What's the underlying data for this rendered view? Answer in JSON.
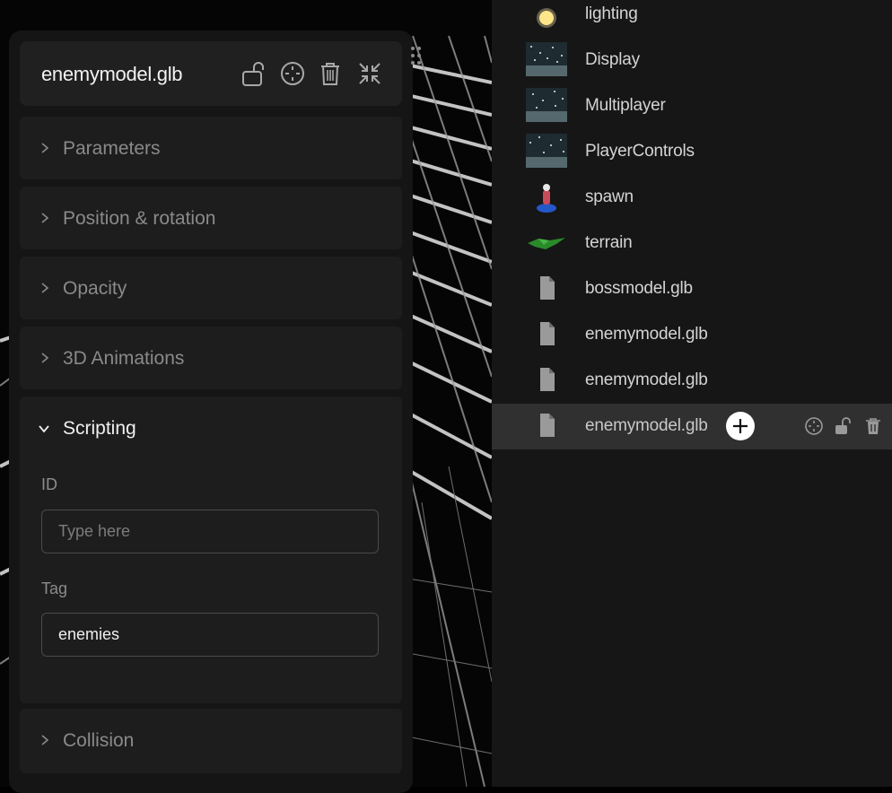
{
  "inspector": {
    "title": "enemymodel.glb",
    "header_icons": [
      "lock-open-icon",
      "focus-target-icon",
      "trash-icon",
      "collapse-icon"
    ],
    "sections": [
      {
        "label": "Parameters",
        "expanded": false
      },
      {
        "label": "Position & rotation",
        "expanded": false
      },
      {
        "label": "Opacity",
        "expanded": false
      },
      {
        "label": "3D Animations",
        "expanded": false
      },
      {
        "label": "Scripting",
        "expanded": true
      },
      {
        "label": "Collision",
        "expanded": false
      }
    ],
    "scripting": {
      "id_label": "ID",
      "id_value": "",
      "id_placeholder": "Type here",
      "tag_label": "Tag",
      "tag_value": "enemies"
    }
  },
  "scene_list": {
    "items": [
      {
        "name": "lighting",
        "icon": "light-bulb-thumbnail"
      },
      {
        "name": "Display",
        "icon": "starfield-thumbnail"
      },
      {
        "name": "Multiplayer",
        "icon": "starfield-thumbnail"
      },
      {
        "name": "PlayerControls",
        "icon": "starfield-thumbnail"
      },
      {
        "name": "spawn",
        "icon": "spawn-character-thumbnail"
      },
      {
        "name": "terrain",
        "icon": "terrain-thumbnail"
      },
      {
        "name": "bossmodel.glb",
        "icon": "model-file-icon"
      },
      {
        "name": "enemymodel.glb",
        "icon": "model-file-icon"
      },
      {
        "name": "enemymodel.glb",
        "icon": "model-file-icon"
      },
      {
        "name": "enemymodel.glb",
        "icon": "model-file-icon",
        "selected": true
      }
    ],
    "selected_row_actions": [
      "add-icon",
      "focus-target-icon",
      "lock-open-icon",
      "trash-icon"
    ]
  },
  "colors": {
    "panel_bg": "#151515",
    "section_bg": "#1d1d1d",
    "list_bg": "#161616",
    "selected_row_bg": "#303030",
    "active_text": "#f0f0f0",
    "muted_text": "#8a8a8a"
  }
}
